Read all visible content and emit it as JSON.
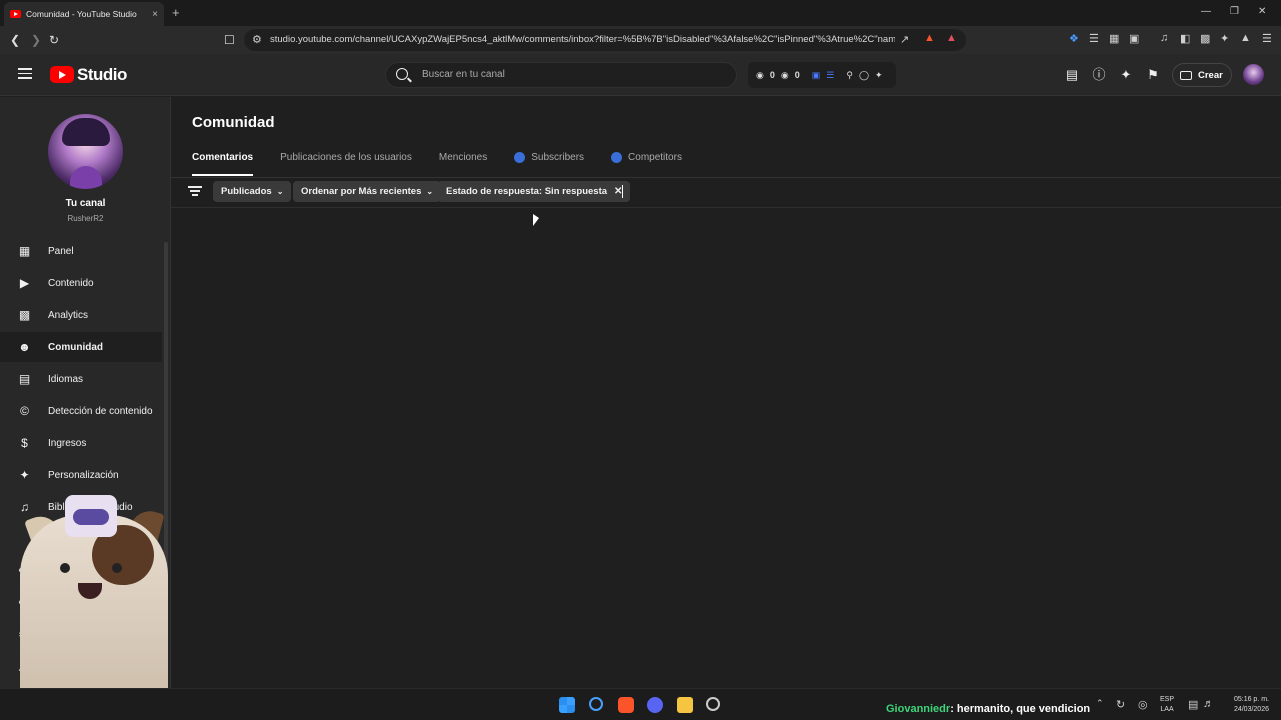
{
  "browser": {
    "tab_title": "Comunidad - YouTube Studio",
    "tab_close": "×",
    "new_tab": "+",
    "url": "studio.youtube.com/channel/UCAXypZWajEP5ncs4_aktlMw/comments/inbox?filter=%5B%7B\"isDisabled\"%3Afalse%2C\"isPinned\"%3Atrue%2C\"name\"..."
  },
  "header": {
    "logo_text": "Studio",
    "search_placeholder": "Buscar en tu canal",
    "ext_count_1": "0",
    "ext_count_2": "0",
    "create_label": "Crear"
  },
  "sidebar": {
    "channel_label": "Tu canal",
    "channel_handle": "RusherR2",
    "items": [
      {
        "label": "Panel",
        "icon": "dashboard-icon"
      },
      {
        "label": "Contenido",
        "icon": "content-icon"
      },
      {
        "label": "Analytics",
        "icon": "analytics-icon"
      },
      {
        "label": "Comunidad",
        "icon": "community-icon",
        "active": true
      },
      {
        "label": "Idiomas",
        "icon": "subtitles-icon"
      },
      {
        "label": "Detección de contenido",
        "icon": "copyright-icon"
      },
      {
        "label": "Ingresos",
        "icon": "dollar-icon"
      },
      {
        "label": "Personalización",
        "icon": "magic-wand-icon"
      },
      {
        "label": "Biblioteca de audio",
        "icon": "audio-library-icon"
      }
    ]
  },
  "main": {
    "title": "Comunidad",
    "tabs": [
      {
        "label": "Comentarios",
        "active": true
      },
      {
        "label": "Publicaciones de los usuarios"
      },
      {
        "label": "Menciones"
      },
      {
        "label": "Subscribers",
        "badge": true
      },
      {
        "label": "Competitors",
        "badge": true
      }
    ],
    "filters": {
      "published": "Publicados",
      "sort": "Ordenar por Más recientes",
      "response_status": "Estado de respuesta: Sin respuesta"
    }
  },
  "taskbar": {
    "chat_user": "Giovanniedr",
    "chat_message": ": hermanito, que vendicion",
    "lang_top": "ESP",
    "lang_bottom": "LAA",
    "time": "05:16 p. m.",
    "date": "24/03/2026"
  },
  "colors": {
    "accent_red": "#ff0000",
    "badge_blue": "#3a6ed8",
    "chat_user_green": "#3fd47a"
  }
}
